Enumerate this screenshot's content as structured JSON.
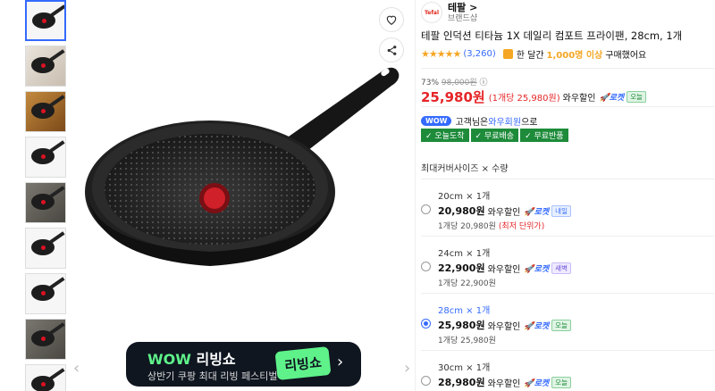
{
  "gallery": {
    "thumbnails": [
      {
        "kind": "pan"
      },
      {
        "kind": "photo"
      },
      {
        "kind": "cook"
      },
      {
        "kind": "pan"
      },
      {
        "kind": "dark"
      },
      {
        "kind": "pan"
      },
      {
        "kind": "pan"
      },
      {
        "kind": "dark"
      },
      {
        "kind": "pan"
      }
    ],
    "prev_arrow": "‹",
    "next_arrow": "›"
  },
  "banner": {
    "title_wow": "WOW",
    "title_rest": " 리빙쇼",
    "subtitle": "상반기 쿠팡 최대 리빙 페스티벌",
    "logo_text": "리빙쇼",
    "chevron": "›"
  },
  "brand": {
    "logo": "Tefal",
    "name": "테팔 >",
    "sub": "브랜드샵"
  },
  "product": {
    "title": "테팔 인덕션 티타늄 1X 데일리 컴포트 프라이팬, 28cm, 1개",
    "stars": "★★★★★",
    "review_count": "(3,260)",
    "buy_prefix": "한 달간",
    "buy_count": "1,000명 이상",
    "buy_suffix": "구매했어요"
  },
  "price": {
    "discount_rate": "73%",
    "original": "98,000원",
    "info_icon": "ⓘ",
    "sale": "25,980원",
    "unit": "(1개당 25,980원)",
    "wow_label": "와우할인",
    "rocket_label": "🚀로켓",
    "badge": "오늘"
  },
  "wow": {
    "pill": "WOW",
    "text_a": "고객님은 ",
    "member": "와우회원",
    "text_b": "으로"
  },
  "benefits": [
    "✓ 오늘도착",
    "✓ 무료배송",
    "✓ 무료반품"
  ],
  "option_header": "최대커버사이즈 × 수량",
  "options": [
    {
      "name": "20cm × 1개",
      "price": "20,980원",
      "wow": "와우할인",
      "rocket": "🚀로켓",
      "badge": "내일",
      "badge_type": "tmr",
      "unit": "1개당 20,980원",
      "lowest": "(최저 단위가)",
      "selected": false
    },
    {
      "name": "24cm × 1개",
      "price": "22,900원",
      "wow": "와우할인",
      "rocket": "🚀로켓",
      "badge": "새벽",
      "badge_type": "new",
      "unit": "1개당 22,900원",
      "lowest": "",
      "selected": false
    },
    {
      "name": "28cm × 1개",
      "price": "25,980원",
      "wow": "와우할인",
      "rocket": "🚀로켓",
      "badge": "오늘",
      "badge_type": "today",
      "unit": "1개당 25,980원",
      "lowest": "",
      "selected": true
    },
    {
      "name": "30cm × 1개",
      "price": "28,980원",
      "wow": "와우할인",
      "rocket": "🚀로켓",
      "badge": "오늘",
      "badge_type": "today",
      "unit": "",
      "lowest": "",
      "selected": false
    }
  ]
}
